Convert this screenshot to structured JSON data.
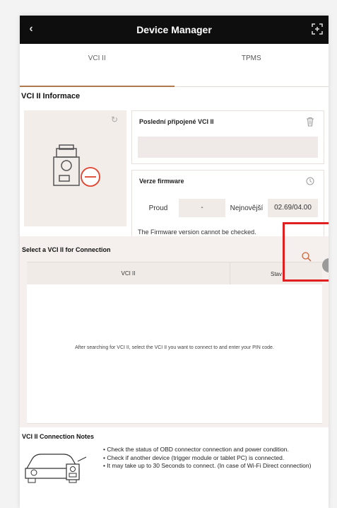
{
  "app": {
    "title": "Device Manager"
  },
  "tabs": [
    {
      "label": "VCI II"
    },
    {
      "label": "TPMS"
    }
  ],
  "vci_info": {
    "section_title": "VCI II Informace",
    "last_connected_label": "Poslední připojené VCI II",
    "firmware": {
      "label": "Verze firmware",
      "current_label": "Proud",
      "current_value": "-",
      "latest_label": "Nejnovější",
      "latest_value": "02.69/04.00",
      "note": "The Firmware version cannot be checked."
    }
  },
  "select_panel": {
    "title": "Select a VCI II for Connection",
    "columns": [
      "VCI II",
      "Stav"
    ],
    "empty_message": "After searching for VCI II, select the VCI II you want to connect to and enter your PIN code."
  },
  "notes": {
    "title": "VCI II Connection Notes",
    "items": [
      "• Check the status of OBD connector connection and power condition.",
      "• Check if another device (trigger module or tablet PC) is connected.",
      "• It may take up to 30 Seconds to connect. (In case of Wi-Fi Direct connection)"
    ]
  },
  "icons": {
    "back": "chevron-left-icon",
    "expand": "expand-icon",
    "refresh": "refresh-icon",
    "delete": "trash-icon",
    "firmware_refresh": "refresh-icon",
    "search": "search-icon",
    "device": "vci-device-icon",
    "car": "car-icon"
  },
  "colors": {
    "accent": "#b07a4e",
    "highlight": "#e02020",
    "titlebar": "#0e0e0e"
  }
}
